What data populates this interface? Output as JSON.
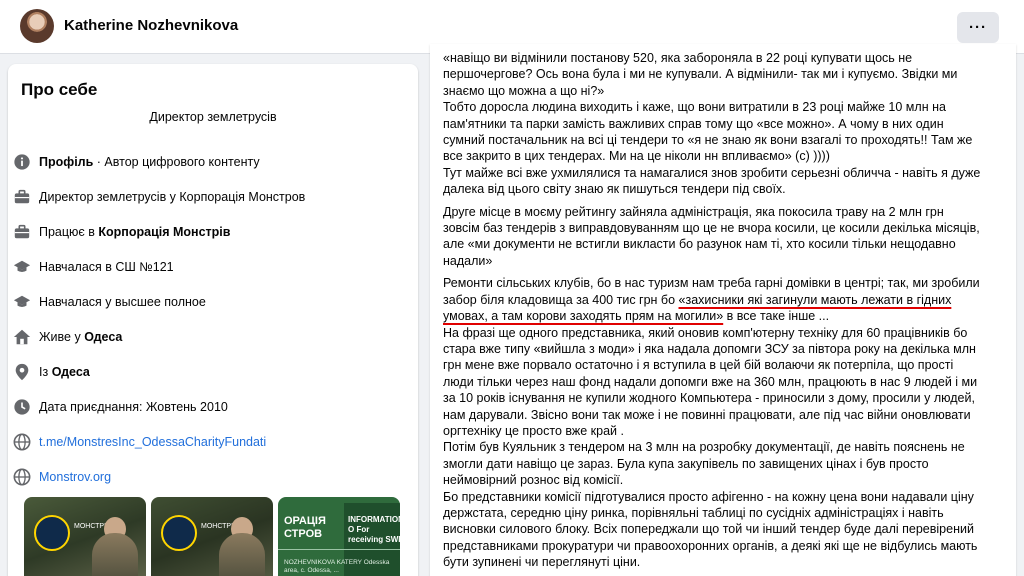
{
  "header": {
    "profile_name": "Katherine Nozhevnikova",
    "more_label": "···"
  },
  "about": {
    "title": "Про себе",
    "subtitle": "Директор землетрусів",
    "rows": [
      {
        "icon": "info-icon",
        "bold": "Профіль",
        "text": " · Автор цифрового контенту"
      },
      {
        "icon": "briefcase-icon",
        "text": "Директор землетрусів у Корпорація Монстров"
      },
      {
        "icon": "briefcase-icon",
        "prefix": "Працює в ",
        "bold": "Корпорація Монстрів"
      },
      {
        "icon": "graduation-cap-icon",
        "text": "Навчалася в СШ №121"
      },
      {
        "icon": "graduation-cap-icon",
        "text": "Навчалася у высшее полное"
      },
      {
        "icon": "home-icon",
        "prefix": "Живе у ",
        "bold": "Одеса"
      },
      {
        "icon": "location-pin-icon",
        "prefix": "Із ",
        "bold": "Одеса"
      },
      {
        "icon": "clock-icon",
        "text": "Дата приєднання: Жовтень 2010"
      },
      {
        "icon": "globe-icon",
        "link": "t.me/MonstresInc_OdessaCharityFundati"
      },
      {
        "icon": "globe-icon",
        "link": "Monstrov.org"
      }
    ],
    "thumbnails": {
      "badge_text": "МОНСТРИ",
      "t3_title": "ОРАЦІЯ СТРОВ",
      "t3_info": "INFORMATION O For receiving SWI",
      "t3_sub": "NOZHEVNIKOVA KATERY Odesska area, c. Odessa, ..."
    }
  },
  "post": {
    "p1": "«навіщо ви відмінили постанову 520, яка забороняла в 22 році купувати щось не першочергове? Ось вона була і ми не купували. А відмінили- так ми і купуємо. Звідки ми знаємо що можна а що ні?»",
    "p2": "Тобто доросла людина виходить і каже, що вони витратили в 23 році майже 10 млн на пам'ятники та парки замість важливих справ тому що «все можно». А чому в них один сумний постачальник на всі ці тендери то «я не знаю як вони взагалі то проходять!! Там же все закрито в цих тендерах. Ми на це ніколи нн впливаємо» (с) ))))",
    "p3": "Тут майже всі вже ухмилялися  та намагалися знов зробити серьезні обличча - навіть я дуже далека від цього світу знаю як пишуться тендери під своїх.",
    "p4": "Друге місце  в моєму рейтингу зайняла адміністрація, яка покосила траву на 2 млн грн зовсім баз тендерів з виправдовуванням що це не вчора косили, це косили декілька місяців, але «ми документи не встигли викласти бо разунок нам ті, хто косили тільки нещодавно надали»",
    "p5_start": "Ремонти сільських клубів, бо в нас туризм нам треба гарні домівки в центрі; так, ми зробили забор біля кладовища за 400 тис грн бо ",
    "p5_underlined": "«захисники які загинули мають лежати в гідних умовах, а там корови заходять прям на могили»",
    "p5_end": " в все таке інше ...",
    "p6": "На фразі ще одного представника, який оновив комп'ютерну техніку для 60 працівників бо стара вже  типу «вийшла з моди» і яка надала допомги ЗСУ за півтора року на декілька млн грн мене вже порвало остаточно і я вступила в цей бій волаючи як потерпіла, що прості люди тільки через наш фонд надали допомги вже на 360 млн, працюють в нас 9 людей і ми за 10 років існування не купили жодного Компьютера - приносили з дому, просили у людей, нам дарували. Звісно вони так може і не повинні працювати, але під час війни оновлювати оргтехніку це просто вже край .",
    "p7": "Потім був Куяльник з тендером на 3 млн на розробку документації, де навіть пояснень не змогли дати навіщо це зараз. Була купа закупівель по завищених цінах і був просто неймовірний рознос від комісії.",
    "p8": "Бо представники комісії підготувалися просто афігенно - на кожну цена вони надавали ціну держстата, середню ціну ринка, порівняльні таблиці по сусідніх адміністраціях і навіть висновки силового блоку. Всіх попереджали що той чи інший тендер буде далі перевірений представниками прокуратури чи правоохоронних органів, а деякі які ще не відбулись мають бути зупинені чи переглянуті ціни."
  },
  "colors": {
    "link": "#216fdb",
    "underline": "#e00000",
    "page_bg": "#f0f2f5"
  }
}
